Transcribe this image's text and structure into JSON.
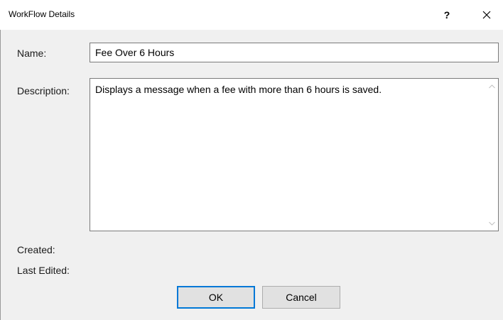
{
  "window": {
    "title": "WorkFlow Details",
    "help_glyph": "?",
    "close_icon": "close-icon"
  },
  "form": {
    "name_label": "Name:",
    "name_value": "Fee Over 6 Hours",
    "description_label": "Description:",
    "description_value": "Displays a message when a fee with more than 6 hours is saved.",
    "created_label": "Created:",
    "created_value": "",
    "last_edited_label": "Last Edited:",
    "last_edited_value": ""
  },
  "buttons": {
    "ok_label": "OK",
    "cancel_label": "Cancel"
  },
  "colors": {
    "dialog_background": "#f0f0f0",
    "titlebar_background": "#ffffff",
    "default_button_border": "#0078d7",
    "button_background": "#e1e1e1"
  }
}
